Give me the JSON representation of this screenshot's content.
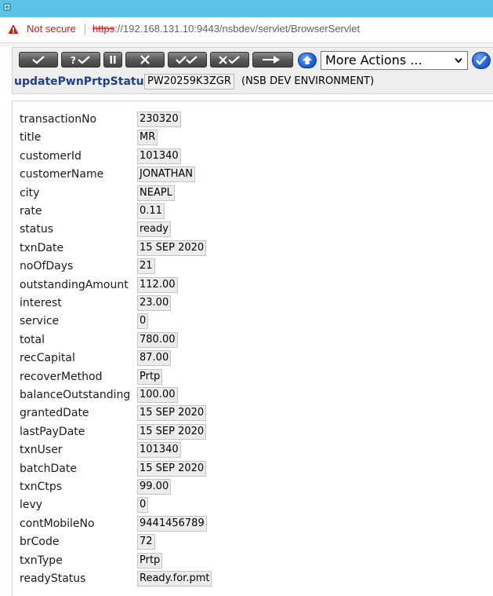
{
  "browser": {
    "security_label": "Not secure",
    "url_scheme": "https",
    "url_rest": "://192.168.131.10:9443/nsbdev/servlet/BrowserServlet"
  },
  "toolbar": {
    "buttons": [
      {
        "name": "commit-button",
        "label": "✓"
      },
      {
        "name": "validate-button",
        "label": "?✓"
      },
      {
        "name": "hold-button",
        "label": "II"
      },
      {
        "name": "delete-button",
        "label": "✕"
      },
      {
        "name": "authorise-button",
        "label": "✓✓"
      },
      {
        "name": "reverse-button",
        "label": "✕✓"
      },
      {
        "name": "run-button",
        "label": "▶"
      }
    ],
    "actions_select_value": "More Actions ...",
    "command_name": "updatePwnPrtpStatus",
    "record_id": "PW20259K3ZGR",
    "environment": "(NSB DEV ENVIRONMENT)"
  },
  "fields": [
    {
      "label": "transactionNo",
      "value": "230320"
    },
    {
      "label": "title",
      "value": "MR"
    },
    {
      "label": "customerId",
      "value": "101340"
    },
    {
      "label": "customerName",
      "value": "JONATHAN"
    },
    {
      "label": "city",
      "value": "NEAPL"
    },
    {
      "label": "rate",
      "value": "0.11"
    },
    {
      "label": "status",
      "value": "ready"
    },
    {
      "label": "txnDate",
      "value": "15 SEP 2020"
    },
    {
      "label": "noOfDays",
      "value": "21"
    },
    {
      "label": "outstandingAmount",
      "value": "112.00"
    },
    {
      "label": "interest",
      "value": "23.00"
    },
    {
      "label": "service",
      "value": "0"
    },
    {
      "label": "total",
      "value": "780.00"
    },
    {
      "label": "recCapital",
      "value": "87.00"
    },
    {
      "label": "recoverMethod",
      "value": "Prtp"
    },
    {
      "label": "balanceOutstanding",
      "value": "100.00"
    },
    {
      "label": "grantedDate",
      "value": "15 SEP 2020"
    },
    {
      "label": "lastPayDate",
      "value": "15 SEP 2020"
    },
    {
      "label": "txnUser",
      "value": "101340"
    },
    {
      "label": "batchDate",
      "value": "15 SEP 2020"
    },
    {
      "label": "txnCtps",
      "value": "99.00"
    },
    {
      "label": "levy",
      "value": "0"
    },
    {
      "label": "contMobileNo",
      "value": "9441456789"
    },
    {
      "label": "brCode",
      "value": "72"
    },
    {
      "label": "txnType",
      "value": "Prtp"
    },
    {
      "label": "readyStatus",
      "value": "Ready.for.pmt"
    }
  ],
  "colors": {
    "title_bar": "#5bc4e6",
    "not_secure": "#c5221f",
    "command_name": "#1f3f8f",
    "action_blue": "#1f5fd6"
  },
  "icons": [
    "device-icon",
    "warning-icon",
    "up-arrow-icon",
    "dropdown-chevron-icon",
    "checkmark-icon"
  ]
}
